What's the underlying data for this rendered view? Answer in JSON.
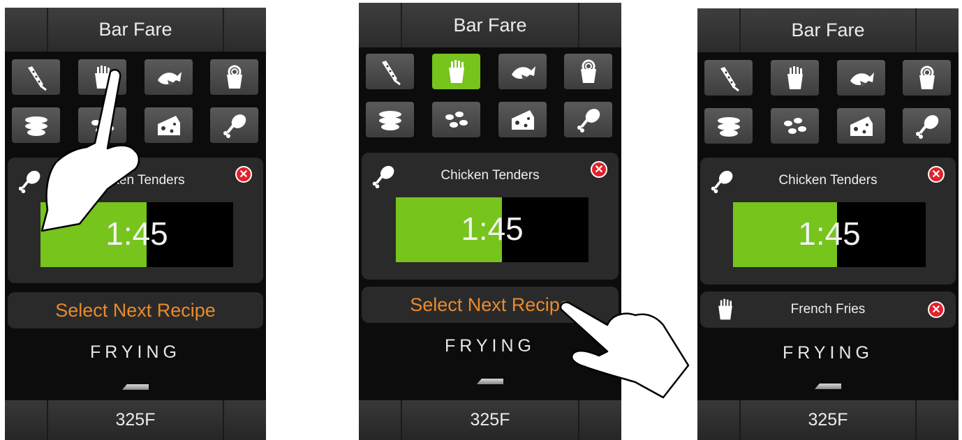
{
  "colors": {
    "accent": "#76c41c",
    "orange": "#ea8a2c",
    "close": "#e3212b"
  },
  "icons_row1": [
    "corn-dog-icon",
    "french-fries-icon",
    "fish-icon",
    "onion-rings-icon"
  ],
  "icons_row2": [
    "onion-petals-icon",
    "mozzarella-bites-icon",
    "cheese-wedge-icon",
    "chicken-drumstick-icon"
  ],
  "panels": [
    {
      "header": "Bar Fare",
      "active_recipe": {
        "name": "Chicken Tenders",
        "time": "1:45",
        "progress": 0.55
      },
      "next_label": "Select Next Recipe",
      "status": "FRYING",
      "temperature": "325F"
    },
    {
      "header": "Bar Fare",
      "selected_tile": "french-fries-icon",
      "active_recipe": {
        "name": "Chicken Tenders",
        "time": "1:45",
        "progress": 0.55
      },
      "next_label": "Select Next Recipe",
      "status": "FRYING",
      "temperature": "325F"
    },
    {
      "header": "Bar Fare",
      "active_recipe": {
        "name": "Chicken Tenders",
        "time": "1:45",
        "progress": 0.54
      },
      "queued_recipe": "French Fries",
      "status": "FRYING",
      "temperature": "325F"
    }
  ]
}
